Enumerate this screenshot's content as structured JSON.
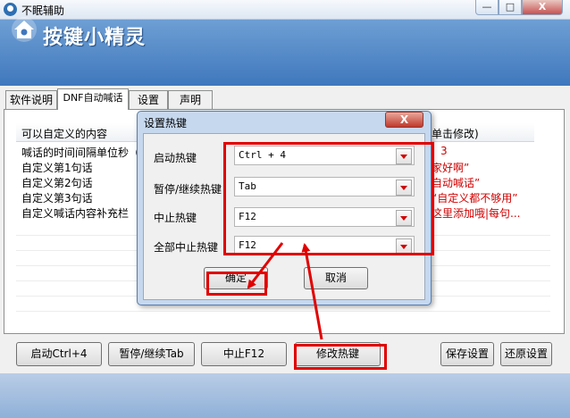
{
  "window": {
    "title": "不眠辅助"
  },
  "banner": {
    "brand": "按键小精灵"
  },
  "tabs": [
    {
      "label": "软件说明",
      "active": false
    },
    {
      "label": "DNF自动喊话",
      "active": true
    },
    {
      "label": "设置",
      "active": false
    },
    {
      "label": "声明",
      "active": false
    }
  ],
  "list": {
    "col1_header": "可以自定义的内容",
    "col2_header": "单击修改)",
    "rows": [
      {
        "label": "喊话的时间间隔单位秒（",
        "value": "3"
      },
      {
        "label": "自定义第1句话",
        "value": "家好啊”"
      },
      {
        "label": "自定义第2句话",
        "value": "自动喊话”"
      },
      {
        "label": "自定义第3句话",
        "value": "“自定义都不够用”"
      },
      {
        "label": "自定义喊话内容补充栏",
        "value": "这里添加哦|每句..."
      }
    ]
  },
  "buttons": {
    "start": "启动Ctrl+4",
    "pause": "暂停/继续Tab",
    "stop": "中止F12",
    "modify_hotkeys": "修改热键",
    "save": "保存设置",
    "restore": "还原设置"
  },
  "dialog": {
    "title": "设置热键",
    "close": "X",
    "fields": [
      {
        "label": "启动热键",
        "value": "Ctrl + 4"
      },
      {
        "label": "暂停/继续热键",
        "value": "Tab"
      },
      {
        "label": "中止热键",
        "value": "F12"
      },
      {
        "label": "全部中止热键",
        "value": "F12"
      }
    ],
    "ok": "确定",
    "cancel": "取消"
  },
  "window_controls": {
    "minimize": "—",
    "maximize": "□",
    "close": "X"
  },
  "annotation_color": "#e10000"
}
